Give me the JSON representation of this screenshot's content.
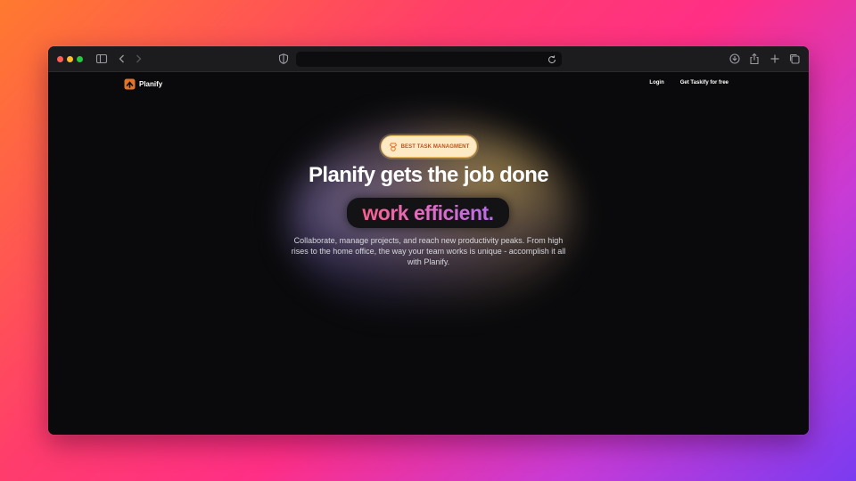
{
  "site": {
    "brand": "Planify",
    "nav": {
      "login": "Login",
      "cta": "Get Taskify for free"
    }
  },
  "hero": {
    "badge": "BEST TASK MANAGMENT",
    "headline": "Planify gets the job done",
    "highlight": "work efficient.",
    "description": "Collaborate, manage projects, and reach new productivity peaks. From high rises to the home office, the way your team works is unique - accomplish it all with Planify."
  },
  "browser": {
    "toolbar_icons": [
      "sidebar-icon",
      "back-icon",
      "forward-icon",
      "shield-icon",
      "reload-icon",
      "download-icon",
      "share-icon",
      "new-tab-icon",
      "tabs-overview-icon"
    ]
  },
  "colors": {
    "accent_orange": "#e0752a",
    "highlight_gradient_start": "#f4608e",
    "highlight_gradient_end": "#b86de8",
    "page_background": "#0a0a0c"
  }
}
